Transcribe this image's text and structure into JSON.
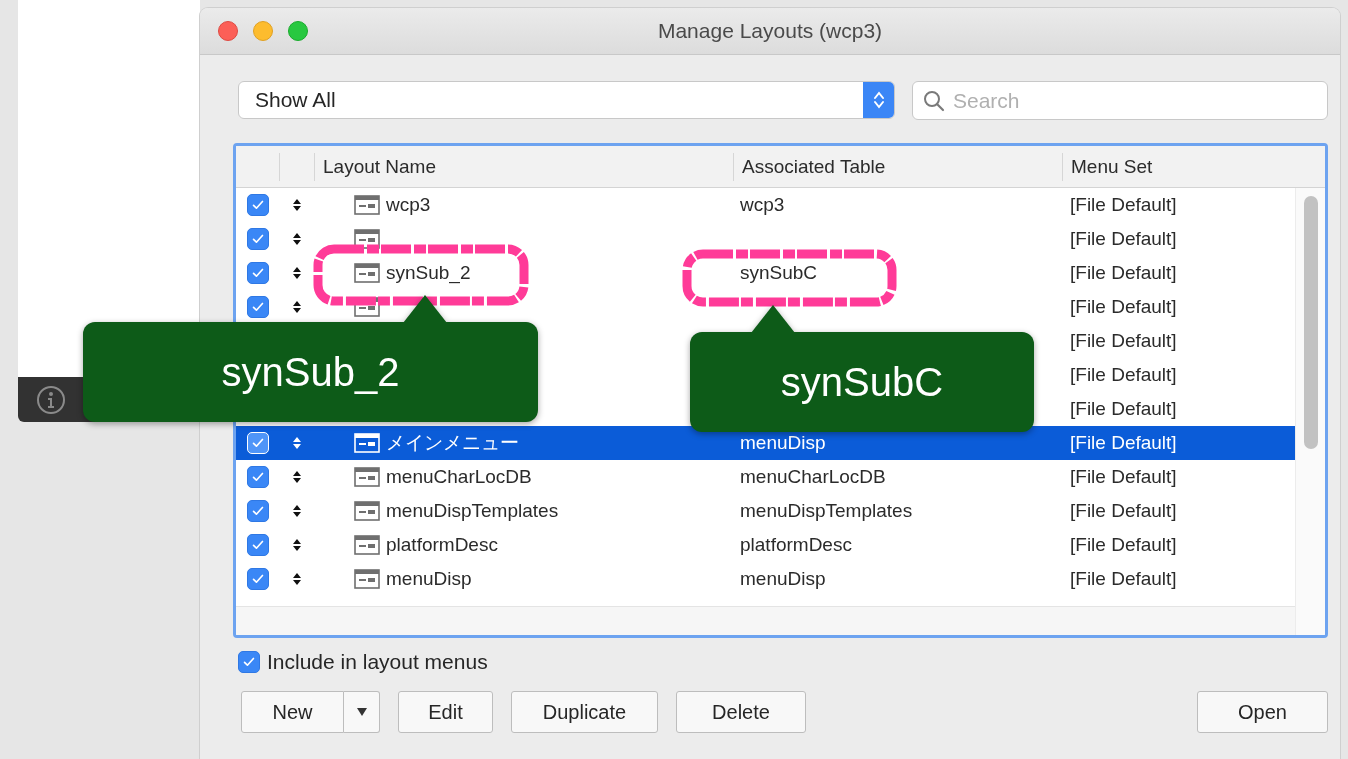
{
  "window": {
    "title": "Manage Layouts (wcp3)"
  },
  "filter": {
    "value": "Show All"
  },
  "search": {
    "placeholder": "Search"
  },
  "table": {
    "columns": [
      "Layout Name",
      "Associated Table",
      "Menu Set"
    ],
    "rows": [
      {
        "checked": true,
        "selected": false,
        "name": "wcp3",
        "table": "wcp3",
        "menu_set": "[File Default]"
      },
      {
        "checked": true,
        "selected": false,
        "menu_set": "[File Default]"
      },
      {
        "checked": true,
        "selected": false,
        "name": "synSub_2",
        "table": "synSubC",
        "menu_set": "[File Default]"
      },
      {
        "checked": true,
        "selected": false,
        "menu_set": "[File Default]"
      },
      {
        "selected": false,
        "menu_set": "[File Default]"
      },
      {
        "selected": false,
        "menu_set": "[File Default]"
      },
      {
        "selected": false,
        "menu_set": "[File Default]"
      },
      {
        "checked": true,
        "selected": true,
        "name": "メインメニュー",
        "table": "menuDisp",
        "menu_set": "[File Default]"
      },
      {
        "checked": true,
        "selected": false,
        "name": "menuCharLocDB",
        "table": "menuCharLocDB",
        "menu_set": "[File Default]"
      },
      {
        "checked": true,
        "selected": false,
        "name": "menuDispTemplates",
        "table": "menuDispTemplates",
        "menu_set": "[File Default]"
      },
      {
        "checked": true,
        "selected": false,
        "name": "platformDesc",
        "table": "platformDesc",
        "menu_set": "[File Default]"
      },
      {
        "checked": true,
        "selected": false,
        "name": "menuDisp",
        "table": "menuDisp",
        "menu_set": "[File Default]"
      }
    ]
  },
  "include_in_menus": {
    "label": "Include in layout menus",
    "checked": true
  },
  "buttons": [
    {
      "label": "New",
      "kind": "split"
    },
    {
      "label": "Edit",
      "kind": "plain"
    },
    {
      "label": "Duplicate",
      "kind": "plain"
    },
    {
      "label": "Delete",
      "kind": "plain"
    },
    {
      "label": "Open",
      "kind": "right"
    }
  ],
  "callouts": [
    {
      "text": "synSub_2"
    },
    {
      "text": "synSubC"
    }
  ]
}
